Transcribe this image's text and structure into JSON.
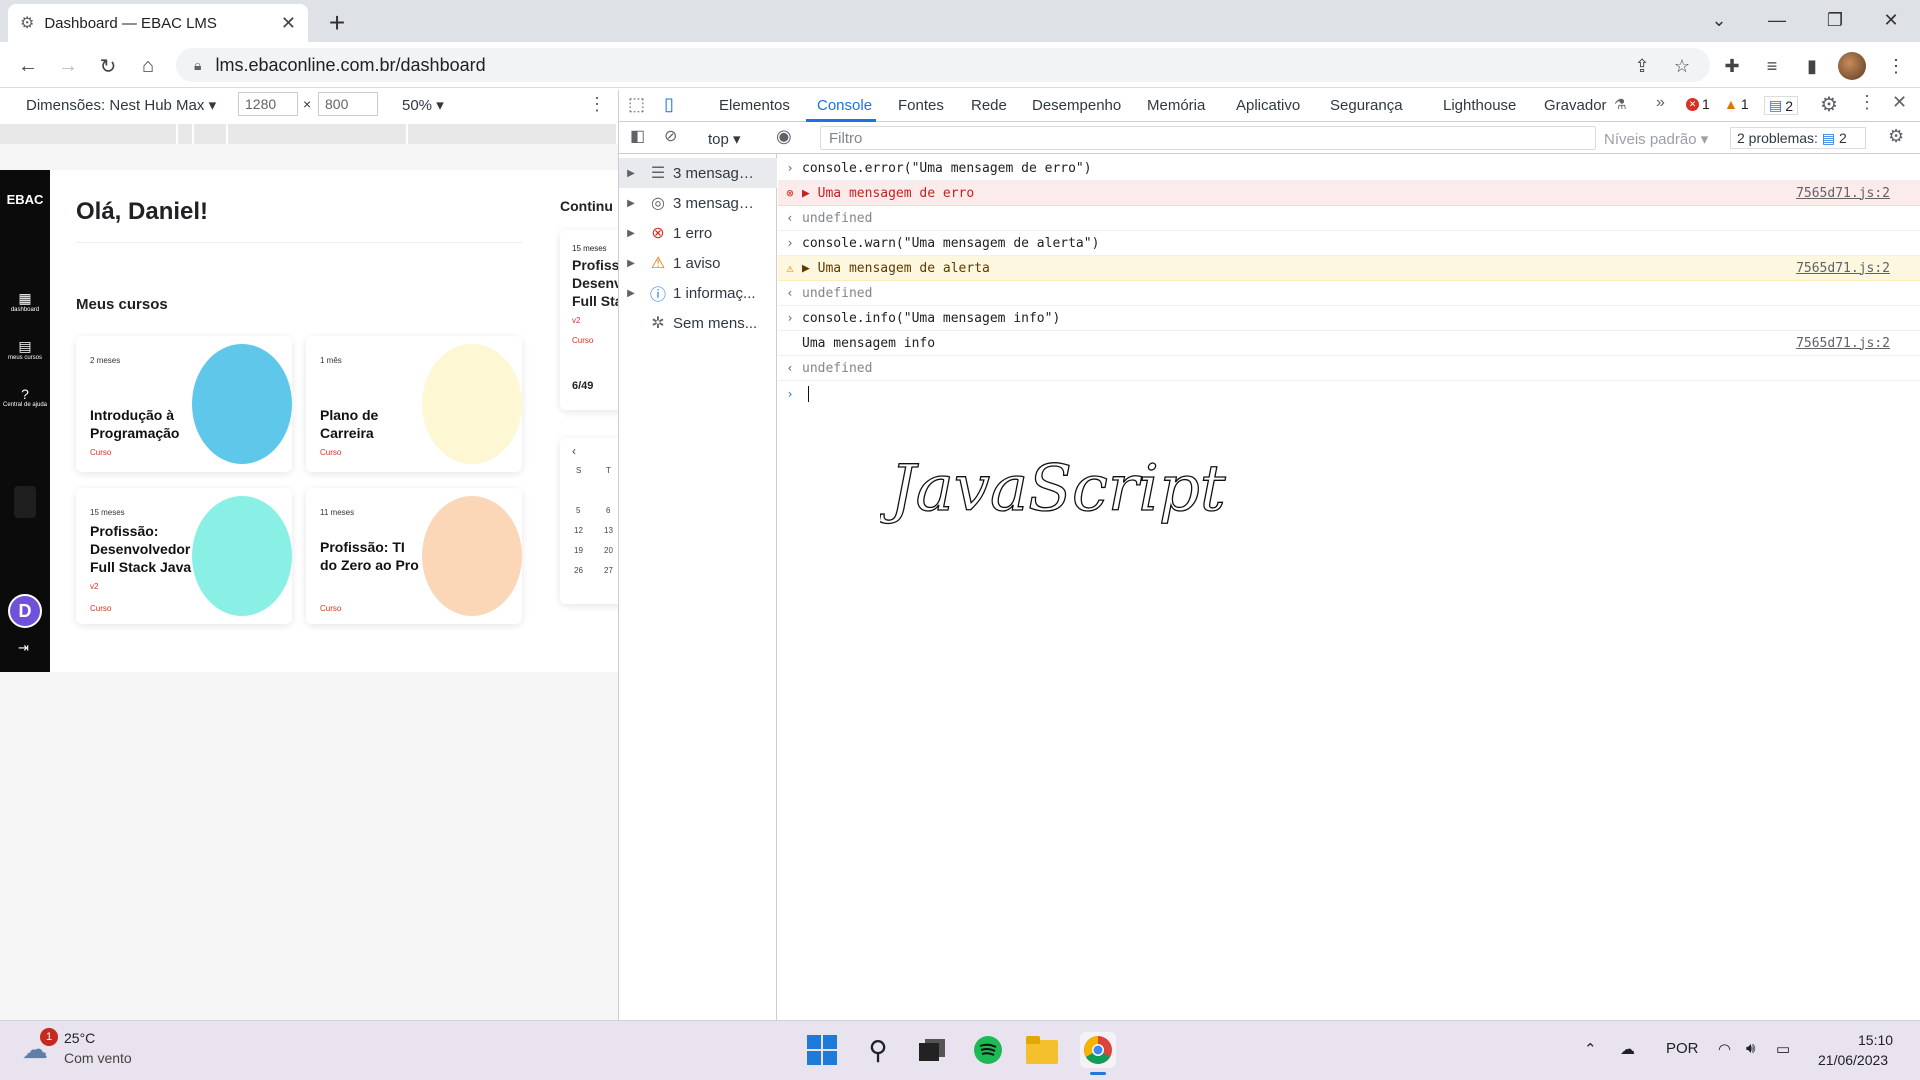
{
  "browser": {
    "tab_title": "Dashboard — EBAC LMS",
    "url": "lms.ebaconline.com.br/dashboard"
  },
  "device_toolbar": {
    "device": "Dimensões: Nest Hub Max",
    "width": "1280",
    "height": "800",
    "zoom": "50%"
  },
  "page": {
    "greeting": "Olá, Daniel!",
    "my_courses_heading": "Meus cursos",
    "continue_heading": "Continu",
    "sidebar": {
      "logo": "EBAC",
      "items": [
        "dashboard",
        "meus cursos",
        "Central de ajuda"
      ],
      "user_initial": "D"
    },
    "courses": [
      {
        "duration": "2 meses",
        "title": "Introdução à Programação",
        "version": "",
        "kind": "Curso"
      },
      {
        "duration": "1 mês",
        "title": "Plano de Carreira",
        "version": "",
        "kind": "Curso"
      },
      {
        "duration": "15 meses",
        "title": "Profissão: Desenvolvedor Full Stack Java",
        "version": "v2",
        "kind": "Curso"
      },
      {
        "duration": "11 meses",
        "title": "Profissão: TI do Zero ao Pro",
        "version": "",
        "kind": "Curso"
      }
    ],
    "continue_card": {
      "duration": "15 meses",
      "title": "Profiss Desenv Full Sta",
      "version": "v2",
      "kind": "Curso",
      "progress": "6/49"
    },
    "calendar": {
      "headers": [
        "S",
        "T"
      ],
      "rows": [
        [
          "5",
          "6"
        ],
        [
          "12",
          "13"
        ],
        [
          "19",
          "20"
        ],
        [
          "26",
          "27"
        ]
      ]
    }
  },
  "devtools": {
    "tabs": [
      "Elementos",
      "Console",
      "Fontes",
      "Rede",
      "Desempenho",
      "Memória",
      "Aplicativo",
      "Segurança",
      "Lighthouse",
      "Gravador"
    ],
    "active_tab": "Console",
    "counts": {
      "errors": "1",
      "warnings": "1",
      "messages": "2"
    },
    "context": "top",
    "filter_placeholder": "Filtro",
    "levels": "Níveis padrão",
    "problems": "2 problemas:",
    "problems_count": "2",
    "sidebar": [
      {
        "icon": "list-icon",
        "label": "3 mensage..."
      },
      {
        "icon": "user-icon",
        "label": "3 mensage..."
      },
      {
        "icon": "error-icon",
        "label": "1 erro"
      },
      {
        "icon": "warning-icon",
        "label": "1 aviso"
      },
      {
        "icon": "info-icon",
        "label": "1 informaç..."
      },
      {
        "icon": "bug-icon",
        "label": "Sem mens..."
      }
    ],
    "console": [
      {
        "type": "input",
        "text": "console.error(\"Uma mensagem de erro\")"
      },
      {
        "type": "error",
        "text": "Uma mensagem de erro",
        "source": "7565d71.js:2"
      },
      {
        "type": "result",
        "text": "undefined"
      },
      {
        "type": "input",
        "text": "console.warn(\"Uma mensagem de alerta\")"
      },
      {
        "type": "warn",
        "text": "Uma mensagem de alerta",
        "source": "7565d71.js:2"
      },
      {
        "type": "result",
        "text": "undefined"
      },
      {
        "type": "input",
        "text": "console.info(\"Uma mensagem info\")"
      },
      {
        "type": "info",
        "text": "Uma mensagem info",
        "source": "7565d71.js:2"
      },
      {
        "type": "result",
        "text": "undefined"
      }
    ],
    "handwriting": "JavaScript"
  },
  "taskbar": {
    "temperature": "25°C",
    "weather": "Com vento",
    "weather_badge": "1",
    "lang": "POR",
    "time": "15:10",
    "date": "21/06/2023"
  }
}
